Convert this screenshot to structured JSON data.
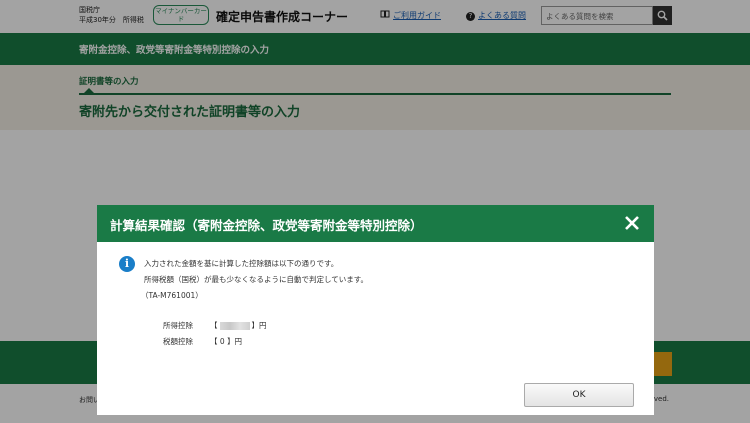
{
  "header": {
    "agency_line1": "国税庁",
    "agency_line2": "平成30年分　所得税",
    "mynumber_badge": "マイナンバーカード",
    "corner_title": "確定申告書作成コーナー",
    "guide_link": "ご利用ガイド",
    "faq_link": "よくある質問",
    "search_placeholder": "よくある質問を検索"
  },
  "section_title": "寄附金控除、政党等寄附金等特別控除の入力",
  "step": {
    "label": "証明書等の入力",
    "heading": "寄附先から交付された証明書等の入力"
  },
  "footer": {
    "left_text": "お問い",
    "right_text": "rved."
  },
  "modal": {
    "title": "計算結果確認（寄附金控除、政党等寄附金等特別控除）",
    "message_line1": "入力された金額を基に計算した控除額は以下の通りです。",
    "message_line2": "所得税額（国税）が最も少なくなるように自動で判定しています。",
    "message_code": "（TA-M761001）",
    "results": [
      {
        "label": "所得控除",
        "bracket_open": "【",
        "value": "",
        "bracket_close": "】円",
        "masked": true
      },
      {
        "label": "税額控除",
        "bracket_open": "【",
        "value": "0",
        "bracket_close": "】円",
        "masked": false
      }
    ],
    "ok_label": "OK"
  },
  "colors": {
    "brand_green": "#1a7a46",
    "info_blue": "#1a7ec8",
    "accent_orange": "#e8a317"
  }
}
